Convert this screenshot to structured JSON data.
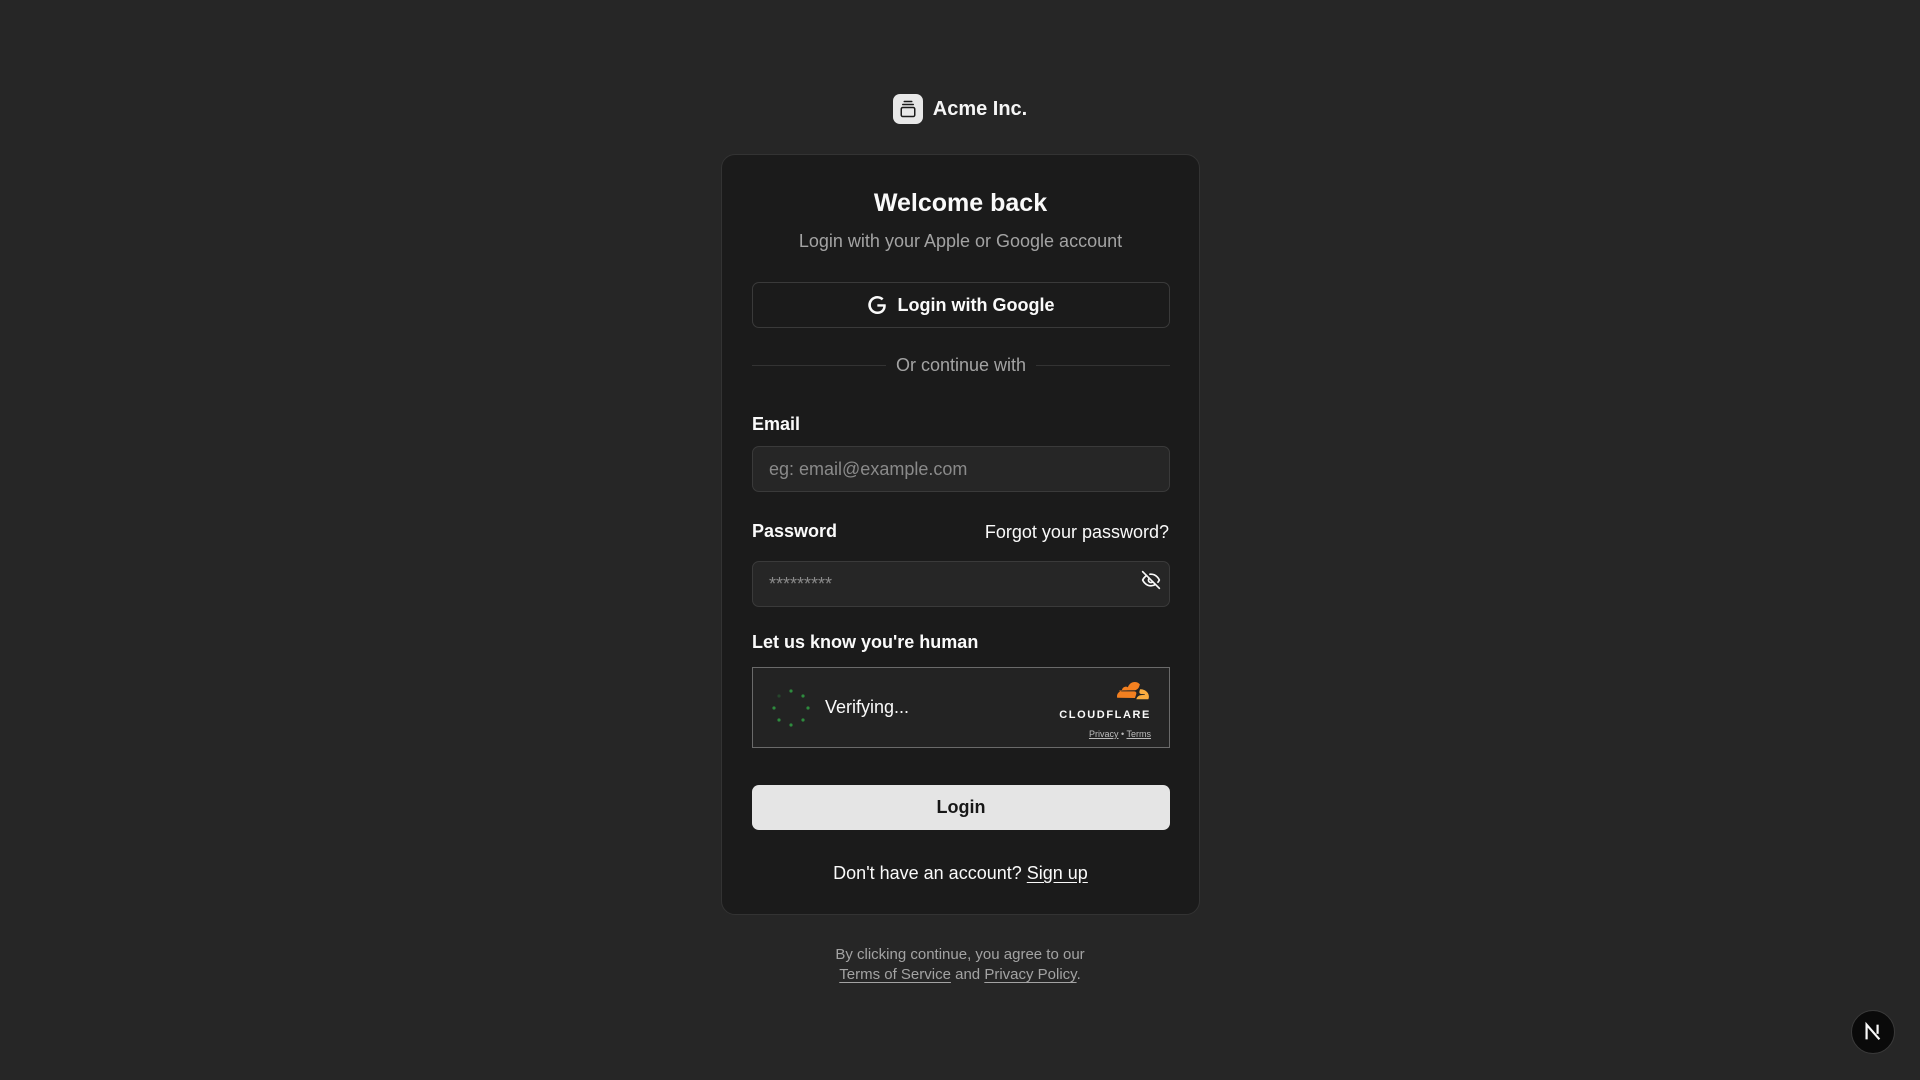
{
  "brand": {
    "name": "Acme Inc.",
    "logo_icon": "gallery-vertical-end-icon"
  },
  "card": {
    "title": "Welcome back",
    "subtitle": "Login with your Apple or Google account",
    "google_button": "Login with Google",
    "divider_text": "Or continue with",
    "email": {
      "label": "Email",
      "placeholder": "eg: email@example.com",
      "value": ""
    },
    "password": {
      "label": "Password",
      "forgot_link": "Forgot your password?",
      "placeholder": "*********",
      "value": "",
      "toggle_icon": "eye-off-icon"
    },
    "captcha": {
      "label": "Let us know you're human",
      "status": "Verifying...",
      "provider": "CLOUDFLARE",
      "privacy": "Privacy",
      "separator": "•",
      "terms": "Terms",
      "brand_color": "#f38020"
    },
    "login_button": "Login",
    "signup_prompt": "Don't have an account?",
    "signup_link": "Sign up"
  },
  "footer": {
    "line1": "By clicking continue, you agree to our",
    "terms_link": "Terms of Service",
    "and": "and",
    "privacy_link": "Privacy Policy",
    "period": "."
  },
  "nextjs_badge": {
    "letter": "N"
  },
  "colors": {
    "background": "#262626",
    "card": "#1b1b1b",
    "primary_button": "#e5e5e5",
    "muted_text": "#a3a3a3"
  }
}
